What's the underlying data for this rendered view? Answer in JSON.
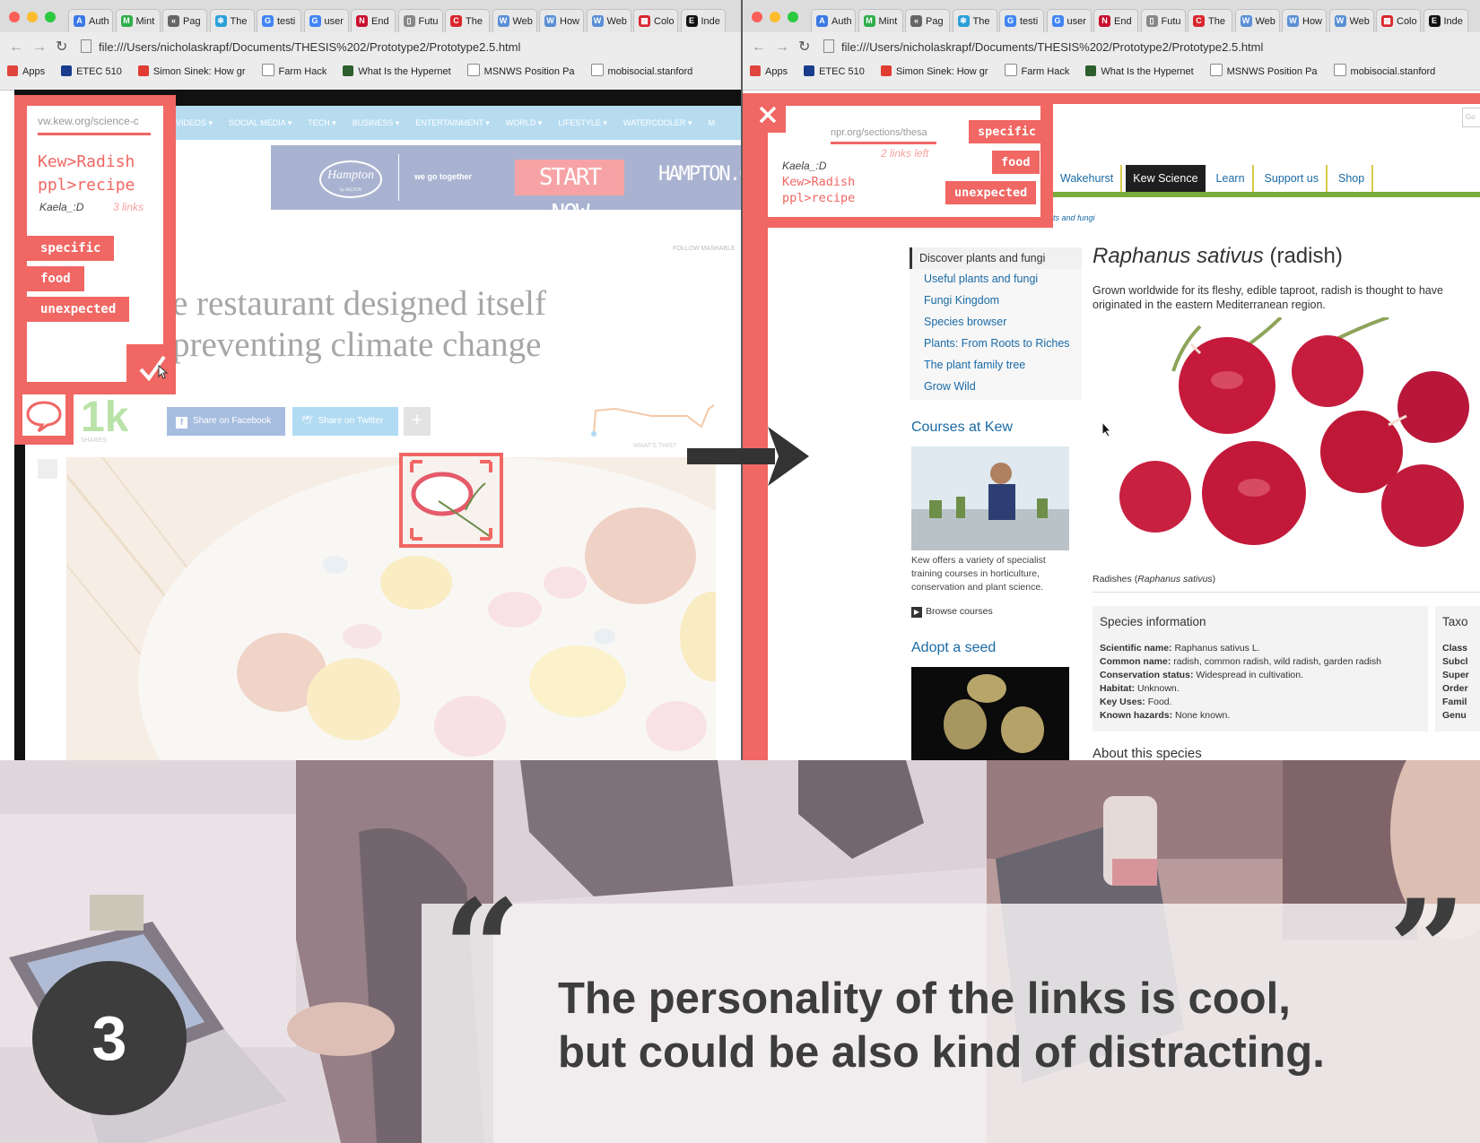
{
  "browser": {
    "address": "file:///Users/nicholaskrapf/Documents/THESIS%202/Prototype2/Prototype2.5.html",
    "tabs": [
      {
        "label": "Auth",
        "color": "#3b78e7",
        "glyph": "A"
      },
      {
        "label": "Mint",
        "color": "#2fae4a",
        "glyph": "M"
      },
      {
        "label": "Pag",
        "color": "#666666",
        "glyph": "«"
      },
      {
        "label": "The",
        "color": "#2a9fd8",
        "glyph": "✻"
      },
      {
        "label": "testi",
        "color": "#4285f4",
        "glyph": "G"
      },
      {
        "label": "user",
        "color": "#4285f4",
        "glyph": "G"
      },
      {
        "label": "End",
        "color": "#c8102e",
        "glyph": "N"
      },
      {
        "label": "Futu",
        "color": "#888888",
        "glyph": "▯"
      },
      {
        "label": "The",
        "color": "#d9262e",
        "glyph": "C"
      },
      {
        "label": "Web",
        "color": "#5a8fd6",
        "glyph": "W"
      },
      {
        "label": "How",
        "color": "#5a8fd6",
        "glyph": "W"
      },
      {
        "label": "Web",
        "color": "#5a8fd6",
        "glyph": "W"
      },
      {
        "label": "Colo",
        "color": "#d9262e",
        "glyph": "▦"
      },
      {
        "label": "Inde",
        "color": "#111111",
        "glyph": "E"
      }
    ],
    "bookmarks": [
      {
        "label": "Apps",
        "color": "#e0443e"
      },
      {
        "label": "ETEC 510",
        "color": "#1a3c8c"
      },
      {
        "label": "Simon Sinek: How gr",
        "color": "#e03c31"
      },
      {
        "label": "Farm Hack",
        "color": "#ffffff"
      },
      {
        "label": "What Is the Hypernet",
        "color": "#2c5f2d"
      },
      {
        "label": "MSNWS Position Pa",
        "color": "#ffffff"
      },
      {
        "label": "mobisocial.stanford",
        "color": "#ffffff"
      }
    ]
  },
  "left_page": {
    "panel": {
      "url": "vw.kew.org/science-c",
      "title_line1": "Kew>Radish",
      "title_line2": "ppl>recipe",
      "user": "Kaela_:D",
      "links_count": "3 links",
      "tags": [
        "specific",
        "food",
        "unexpected"
      ],
      "share_count": "1k",
      "shares_label": "SHARES"
    },
    "site_nav": [
      "VIDEOS",
      "SOCIAL MEDIA",
      "TECH",
      "BUSINESS",
      "ENTERTAINMENT",
      "WORLD",
      "LIFESTYLE",
      "WATERCOOLER",
      "M"
    ],
    "ad": {
      "brand": "Hampton",
      "sub": "by HILTON",
      "tagline": "we go together",
      "cta": "START NOW",
      "domain": "HAMPTON.CO"
    },
    "follow_label": "FOLLOW MASHABLE",
    "headline_line1": "e restaurant designed itself",
    "headline_line2": "preventing climate change",
    "share_facebook": "Share on Facebook",
    "share_twitter": "Share on Twitter",
    "whats_this": "WHAT'S THIS?"
  },
  "right_page": {
    "panel": {
      "url": "npr.org/sections/thesa",
      "links_left": "2 links left",
      "user": "Kaela_:D",
      "title_line1": "Kew>Radish",
      "title_line2": "ppl>recipe",
      "tags": [
        "specific",
        "food",
        "unexpected"
      ]
    },
    "kew_nav": [
      "Wakehurst",
      "Kew Science",
      "Learn",
      "Support us",
      "Shop"
    ],
    "breadcrumb": "ts and fungi",
    "sidebar": {
      "header": "Discover plants and fungi",
      "links": [
        "Useful plants and fungi",
        "Fungi Kingdom",
        "Species browser",
        "Plants: From Roots to Riches",
        "The plant family tree",
        "Grow Wild"
      ],
      "courses_title": "Courses at Kew",
      "courses_text": "Kew offers a variety of specialist training courses in horticulture, conservation and plant science.",
      "browse_courses": "Browse courses",
      "adopt_title": "Adopt a seed"
    },
    "species": {
      "title_italic": "Raphanus sativus",
      "title_plain": "(radish)",
      "intro": "Grown worldwide for its fleshy, edible taproot, radish is thought to have originated in the eastern Mediterranean region.",
      "caption_plain": "Radishes (",
      "caption_italic": "Raphanus sativus",
      "caption_end": ")",
      "info_title": "Species information",
      "taxo_title": "Taxo",
      "facts": [
        {
          "k": "Scientific name:",
          "v": "Raphanus sativus L."
        },
        {
          "k": "Common name:",
          "v": "radish, common radish, wild radish, garden radish"
        },
        {
          "k": "Conservation status:",
          "v": "Widespread in cultivation."
        },
        {
          "k": "Habitat:",
          "v": "Unknown."
        },
        {
          "k": "Key Uses:",
          "v": "Food."
        },
        {
          "k": "Known hazards:",
          "v": "None known."
        }
      ],
      "taxo_rows": [
        "Class",
        "Subcl",
        "Super",
        "Order",
        "Famil",
        "Genu"
      ],
      "about_title": "About this species"
    }
  },
  "quote": {
    "number": "3",
    "line1": "The personality of the links is cool,",
    "line2": "but could be also kind of distracting.",
    "open_mark": "“",
    "close_mark": "”"
  },
  "colors": {
    "accent": "#f06763",
    "dark": "#3d3d3d"
  }
}
